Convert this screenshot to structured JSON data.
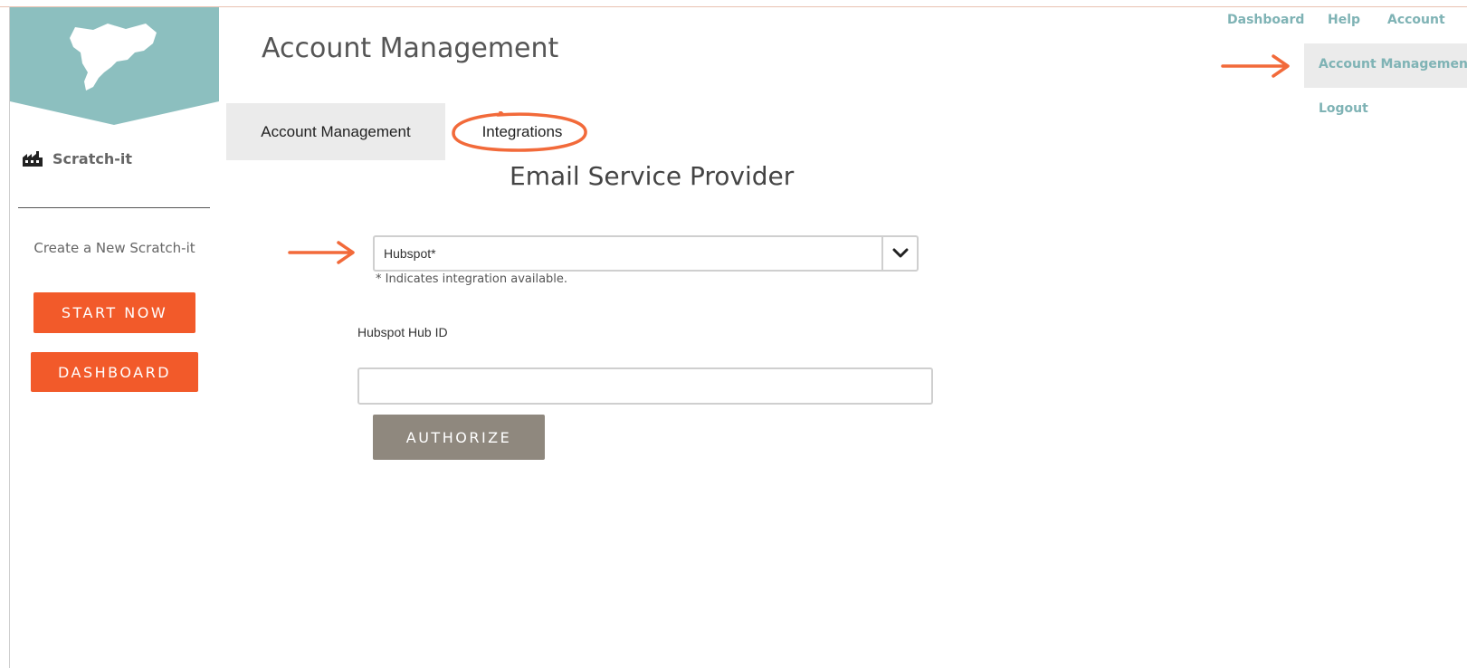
{
  "header": {
    "page_title": "Account Management"
  },
  "sidebar": {
    "brand_label": "Scratch-it",
    "create_label": "Create a New Scratch-it",
    "start_now_label": "START NOW",
    "dashboard_label": "DASHBOARD",
    "brand_icon": "factory-icon",
    "logo_icon": "scratch-logo-icon"
  },
  "tabs": [
    {
      "label": "Account Management",
      "active": true
    },
    {
      "label": "Integrations",
      "active": false
    }
  ],
  "main": {
    "section_title": "Email Service Provider",
    "provider_select": {
      "value": "Hubspot*",
      "chevron_icon": "chevron-down-icon"
    },
    "provider_note": "* Indicates integration available.",
    "hub_id_label": "Hubspot Hub ID",
    "hub_id_value": "",
    "authorize_label": "AUTHORIZE"
  },
  "top_nav": {
    "dashboard": "Dashboard",
    "help": "Help",
    "account": "Account",
    "account_menu": {
      "account_management": "Account Management",
      "logout": "Logout"
    }
  },
  "colors": {
    "accent_teal": "#8cbfbf",
    "link_teal": "#7fb3b5",
    "button_orange": "#f25a2a",
    "authorize_gray": "#8f887e",
    "annotation_orange": "#f26a3a"
  }
}
